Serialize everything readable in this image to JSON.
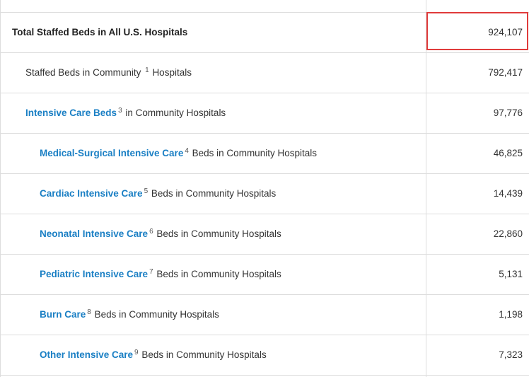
{
  "rows": [
    {
      "link": "",
      "sup": "",
      "text": "Total Staffed Beds in All U.S. Hospitals",
      "value": "924,107"
    },
    {
      "link": "",
      "sup": "1",
      "text_before": "Staffed Beds in Community",
      "text": "Hospitals",
      "value": "792,417"
    },
    {
      "link": "Intensive Care Beds",
      "sup": "3",
      "text": "in Community Hospitals",
      "value": "97,776"
    },
    {
      "link": "Medical-Surgical Intensive Care",
      "sup": "4",
      "text": "Beds in Community Hospitals",
      "value": "46,825"
    },
    {
      "link": "Cardiac Intensive Care",
      "sup": "5",
      "text": "Beds in Community Hospitals",
      "value": "14,439"
    },
    {
      "link": "Neonatal Intensive Care",
      "sup": "6",
      "text": "Beds in Community Hospitals",
      "value": "22,860"
    },
    {
      "link": "Pediatric Intensive Care",
      "sup": "7",
      "text": "Beds in Community Hospitals",
      "value": "5,131"
    },
    {
      "link": "Burn Care",
      "sup": "8",
      "text": "Beds in Community Hospitals",
      "value": "1,198"
    },
    {
      "link": "Other Intensive Care",
      "sup": "9",
      "text": "Beds in Community Hospitals",
      "value": "7,323"
    }
  ],
  "colors": {
    "link": "#1a7fc4",
    "highlight_border": "#e03b3b",
    "grid": "#dddddd"
  }
}
